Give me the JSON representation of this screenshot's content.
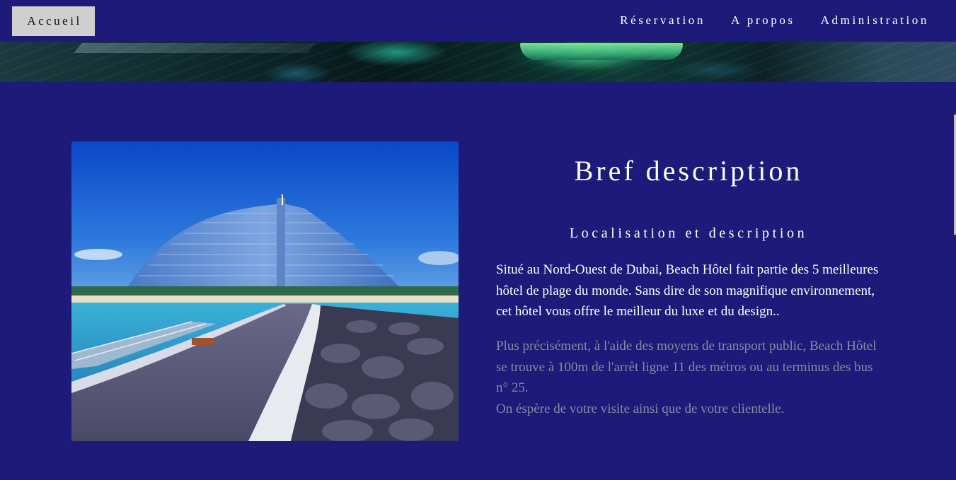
{
  "nav": {
    "home_label": "Accueil",
    "links": [
      "Réservation",
      "A propos",
      "Administration"
    ]
  },
  "hero": {
    "image_alt": "banner-marina-photo"
  },
  "main": {
    "photo": "hotel-beach-photo",
    "title": "Bref description",
    "subtitle": "Localisation et description",
    "paragraph1": "Situé au Nord-Ouest de Dubai, Beach Hôtel fait partie des 5 meilleures hôtel de plage du monde. Sans dire de son magnifique environnement, cet hôtel vous offre le meilleur du luxe et du design..",
    "paragraph2_line1": "Plus précisément, à l'aide des moyens de transport public, Beach Hôtel se trouve à 100m de l'arrêt ligne 11 des métros ou au terminus des bus n° 25.",
    "paragraph2_line2": "On éspère de votre visite ainsi que de votre clientelle."
  },
  "colors": {
    "background": "#1d1a7a",
    "home_button": "#cfcfcf",
    "text_primary": "#ffffff",
    "text_muted": "#8a8a9c"
  }
}
